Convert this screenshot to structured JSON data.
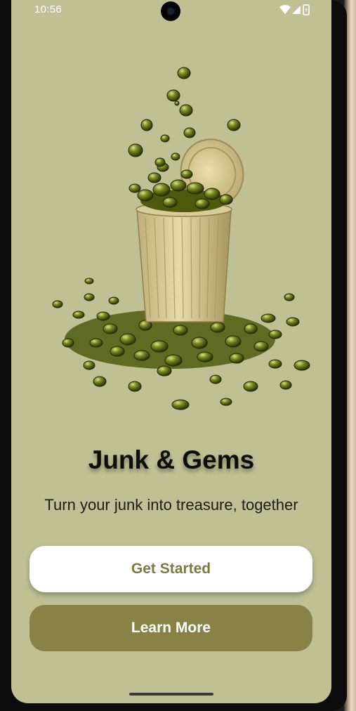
{
  "status_bar": {
    "time": "10:56",
    "icons": [
      "wifi-icon",
      "cellular-signal-icon",
      "battery-icon"
    ]
  },
  "hero": {
    "image": "trash-can-overflowing-with-green-gems-illustration"
  },
  "welcome": {
    "title": "Junk & Gems",
    "tagline": "Turn your junk into treasure, together"
  },
  "actions": {
    "primary_label": "Get Started",
    "secondary_label": "Learn More"
  },
  "colors": {
    "background": "#bfc195",
    "primary_button_bg": "#ffffff",
    "primary_button_text": "#7b7a42",
    "secondary_button_bg": "#888247",
    "secondary_button_text": "#ffffff",
    "gem": "#5d6a12"
  }
}
